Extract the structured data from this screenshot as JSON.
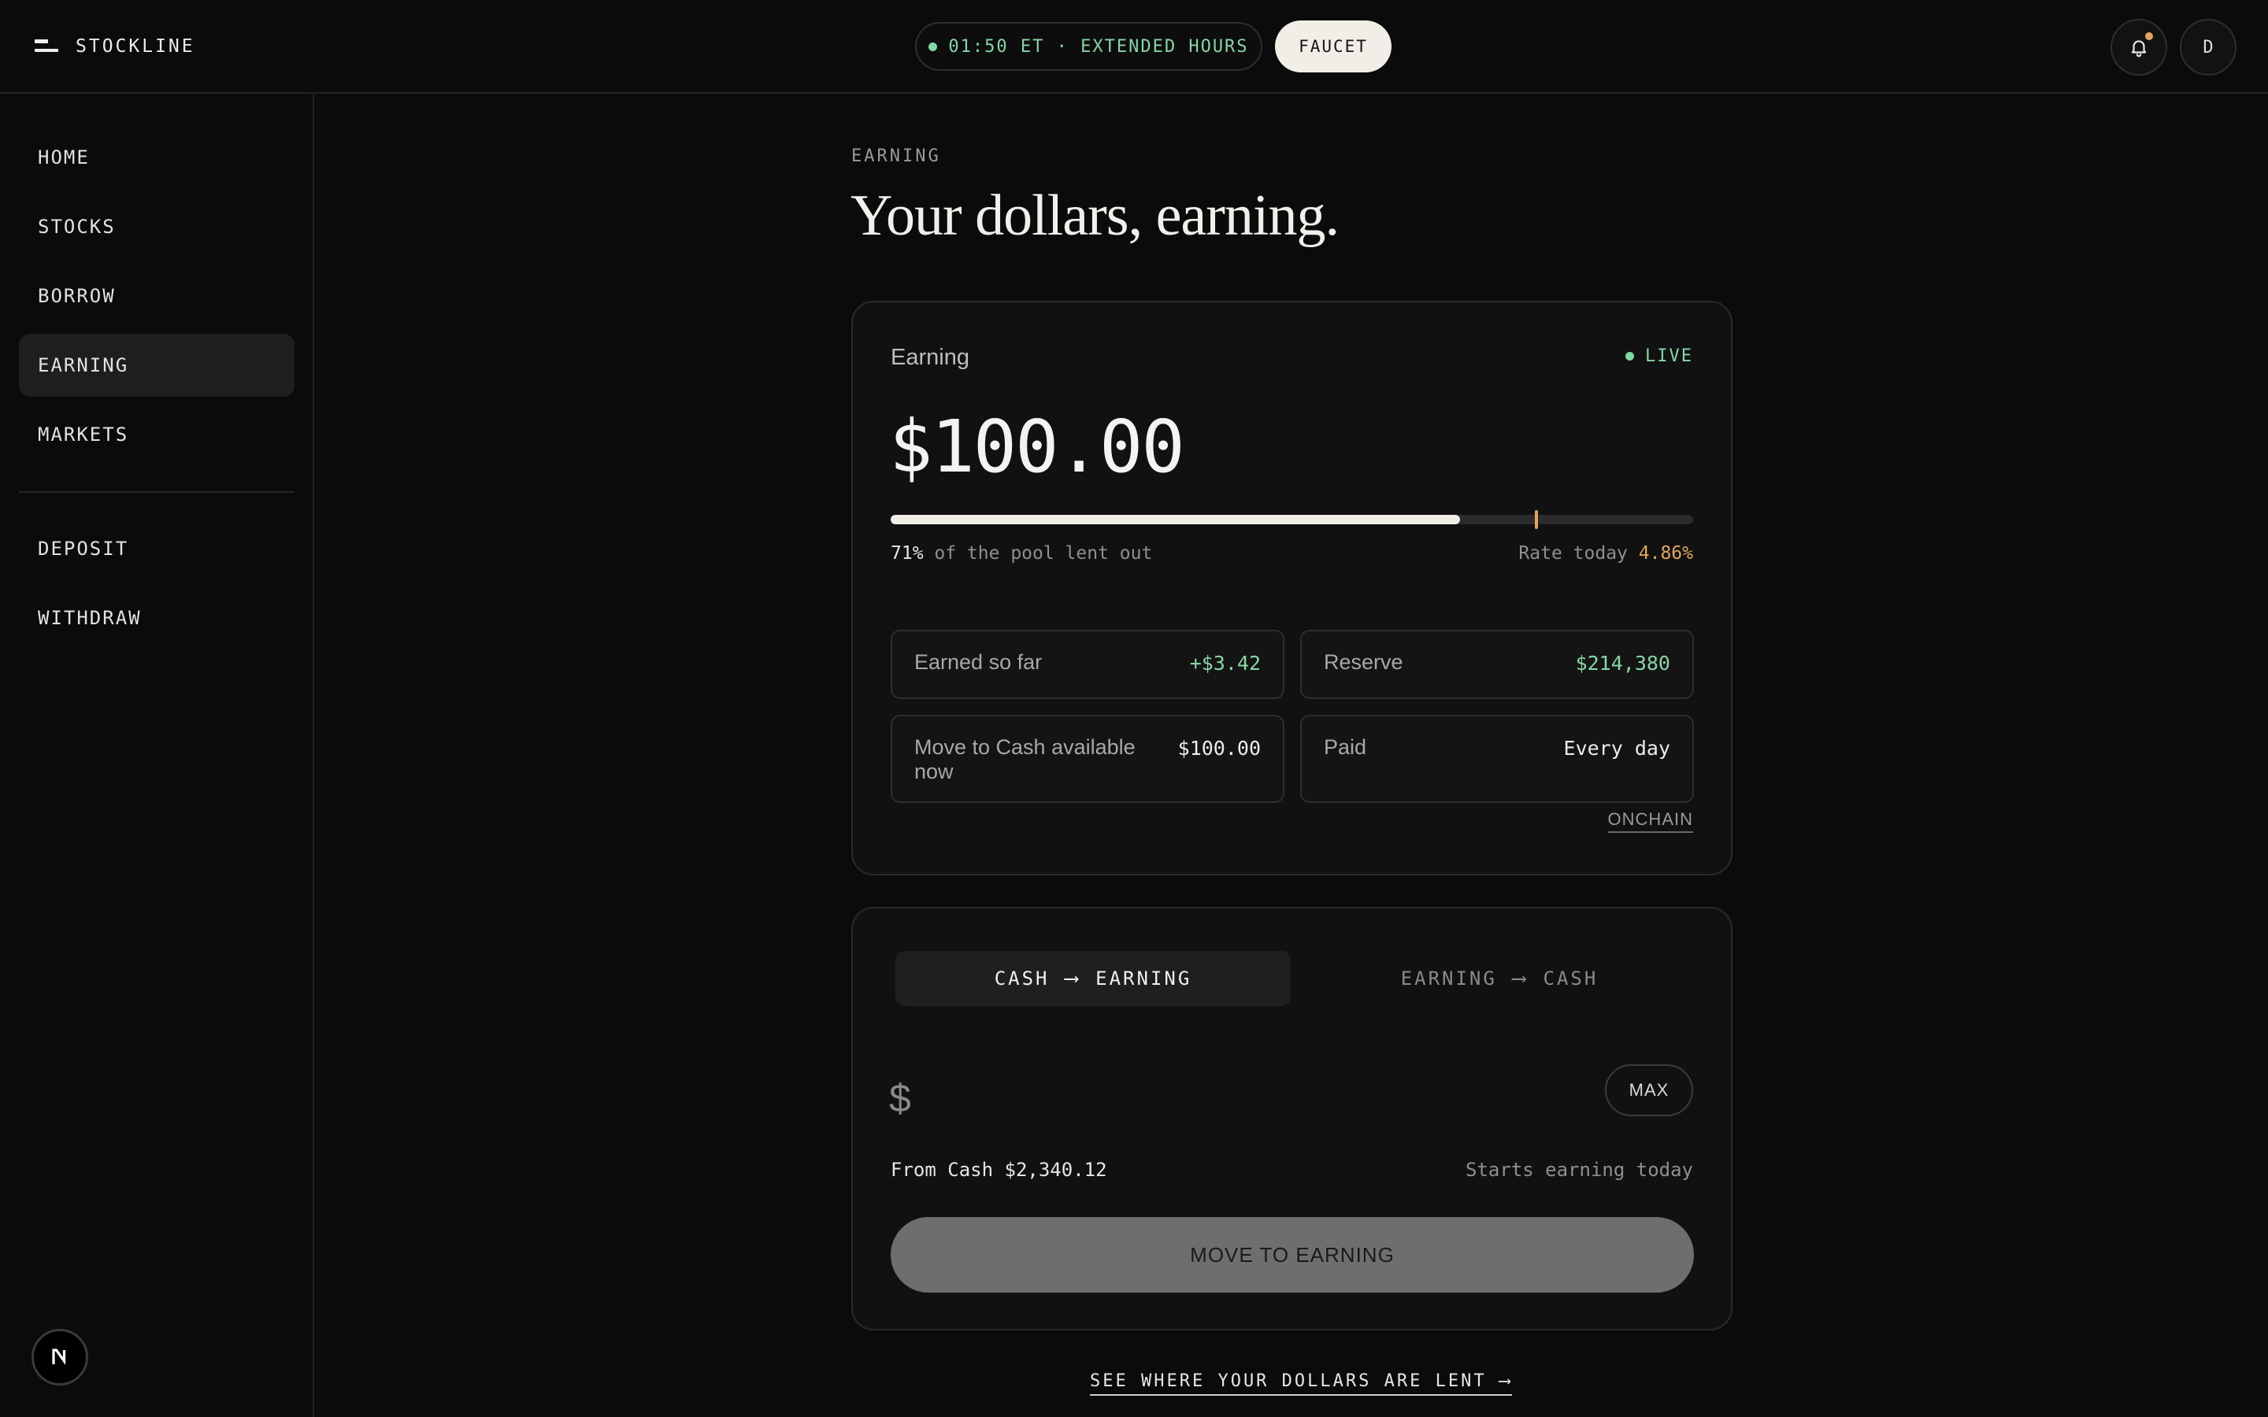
{
  "header": {
    "brand": "STOCKLINE",
    "session_status": "01:50 ET · EXTENDED HOURS",
    "faucet_label": "FAUCET",
    "avatar_initial": "D",
    "icons": {
      "brand": "stockline-logo-icon",
      "bell": "bell-icon"
    },
    "colors": {
      "status_green": "#86d6a6",
      "notification_dot": "#e2a45c"
    }
  },
  "sidebar": {
    "items": [
      {
        "label": "HOME",
        "active": false
      },
      {
        "label": "STOCKS",
        "active": false
      },
      {
        "label": "BORROW",
        "active": false
      },
      {
        "label": "EARNING",
        "active": true
      },
      {
        "label": "MARKETS",
        "active": false
      }
    ],
    "secondary_items": [
      {
        "label": "DEPOSIT"
      },
      {
        "label": "WITHDRAW"
      }
    ],
    "badge_icon": "n-logo-icon"
  },
  "main": {
    "eyebrow": "EARNING",
    "title": "Your dollars, earning.",
    "summary": {
      "label": "Earning",
      "live_label": "LIVE",
      "balance": "$100.00",
      "utilization_fraction": 0.71,
      "rate_marker_fraction": 0.805,
      "pool_pct": "71%",
      "pool_text": " of the pool lent out",
      "rate_label": "Rate today ",
      "rate_value": "4.86%",
      "stats": [
        {
          "label": "Earned so far",
          "value": "+$3.42"
        },
        {
          "label": "Reserve",
          "value": "$214,380"
        },
        {
          "label": "Move to Cash available now",
          "value": "$100.00"
        },
        {
          "label": "Paid",
          "value": "Every day"
        }
      ],
      "onchain_link": "ONCHAIN",
      "accent_color": "#e2a45c"
    },
    "transfer": {
      "tabs": [
        {
          "from": "CASH",
          "to": "EARNING",
          "active": true
        },
        {
          "from": "EARNING",
          "to": "CASH",
          "active": false
        }
      ],
      "arrow": "⟶",
      "currency_symbol": "$",
      "max_label": "MAX",
      "from_cash": "From Cash $2,340.12",
      "starts_text": "Starts earning today",
      "submit_label": "MOVE TO EARNING"
    },
    "footer_link": "SEE WHERE YOUR DOLLARS ARE LENT ⟶"
  }
}
